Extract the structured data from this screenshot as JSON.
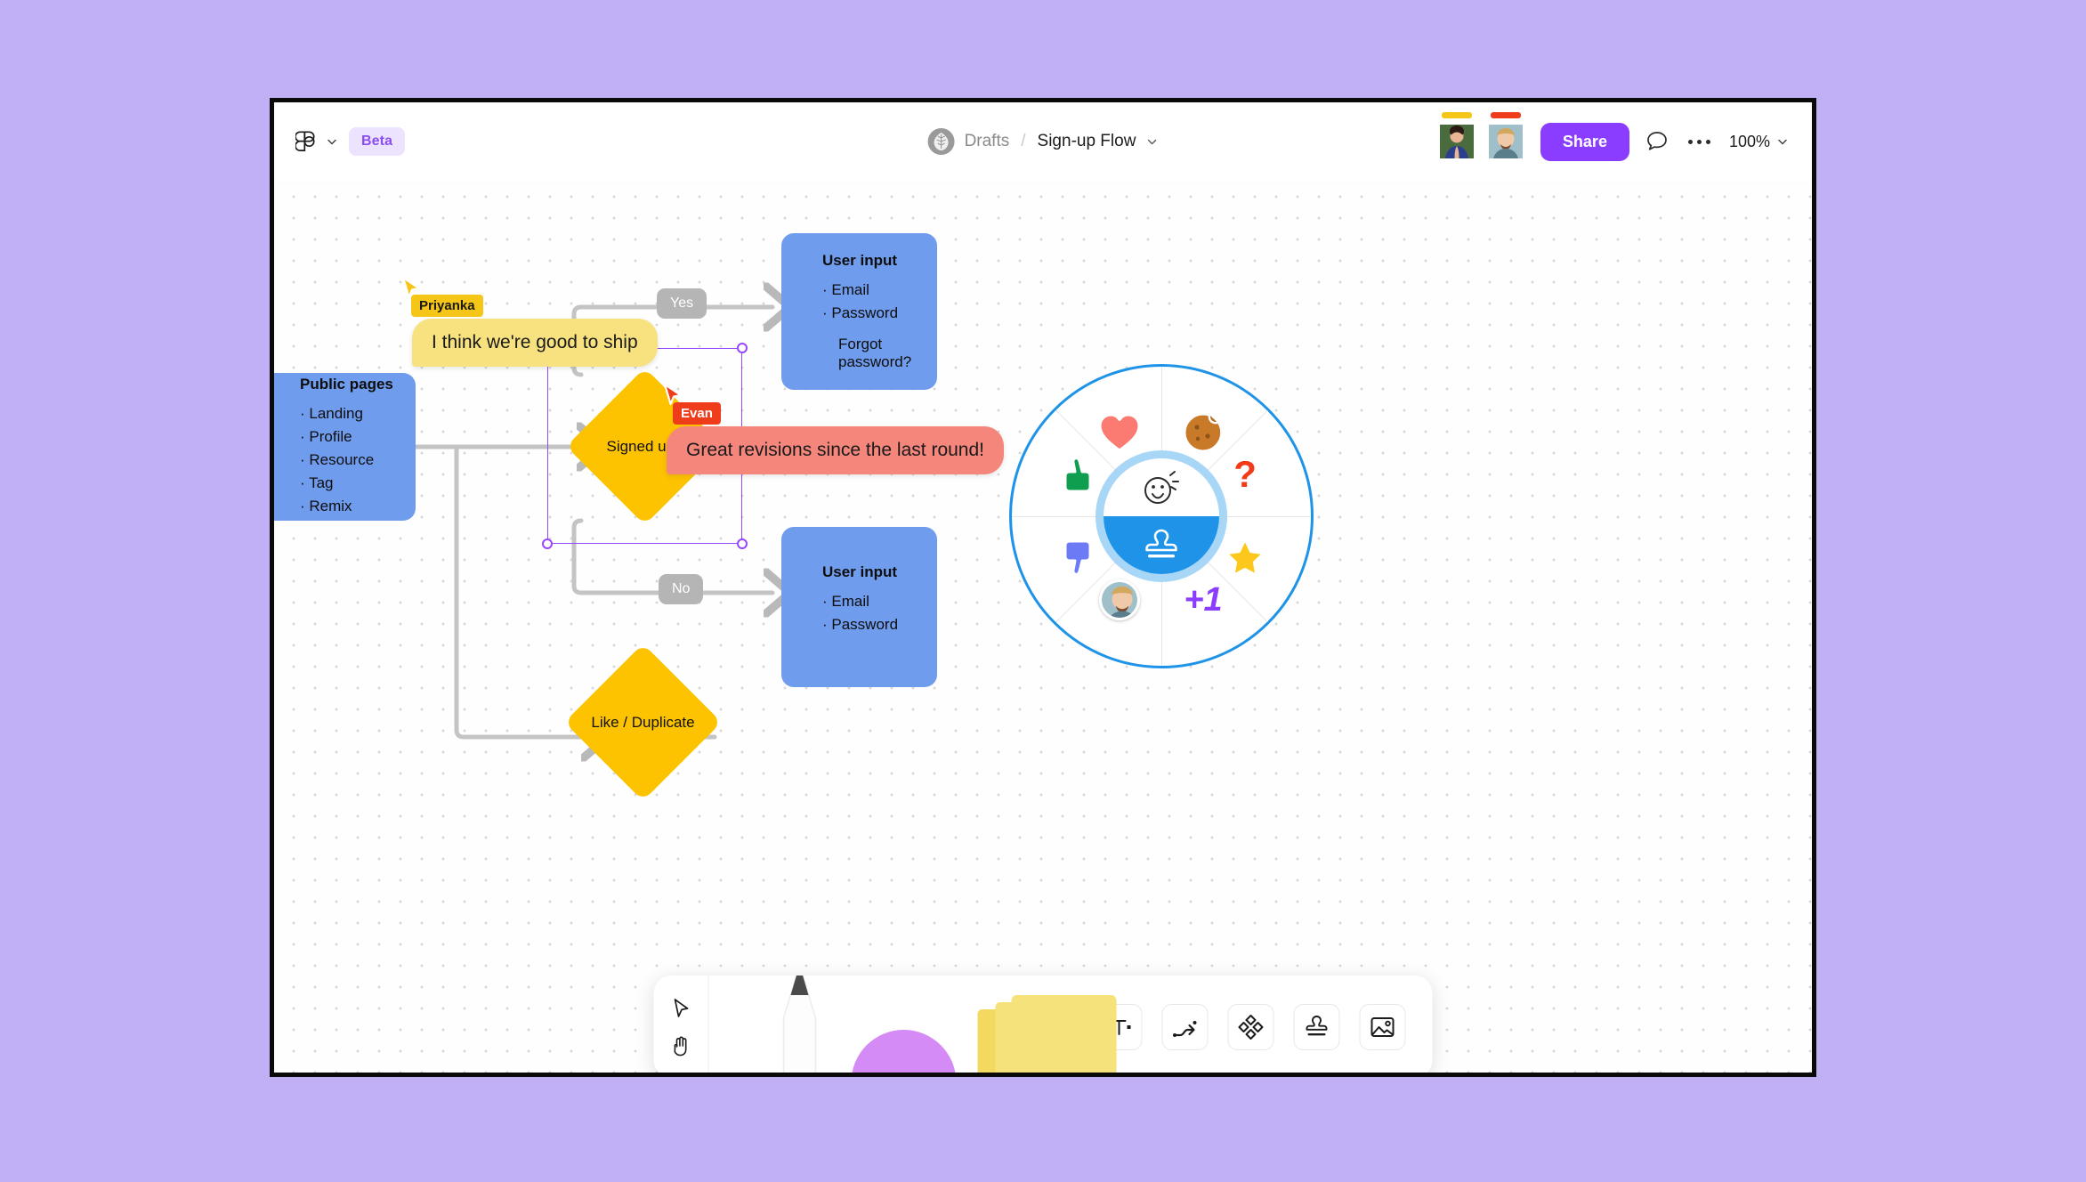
{
  "app": {
    "logo_icon": "figma-logo-icon",
    "logo_chevron_icon": "chevron-down-icon",
    "beta_badge": "Beta"
  },
  "breadcrumb": {
    "project": "Drafts",
    "separator": "/",
    "file_name": "Sign-up Flow",
    "chevron_icon": "chevron-down-icon",
    "avatar_icon": "leaf-avatar-icon"
  },
  "topbar_right": {
    "collaborators": [
      {
        "name": "Priyanka",
        "color": "#f5c518"
      },
      {
        "name": "Evan",
        "color": "#ef3d1b"
      }
    ],
    "share_label": "Share",
    "comment_icon": "comment-bubble-icon",
    "more_icon": "more-options-icon",
    "zoom_level": "100%",
    "zoom_chevron_icon": "chevron-down-icon"
  },
  "canvas": {
    "nodes": [
      {
        "id": "public-pages",
        "type": "rect",
        "title": "Public pages",
        "items": [
          "Landing",
          "Profile",
          "Resource",
          "Tag",
          "Remix"
        ],
        "color": "#6f9ced"
      },
      {
        "id": "user-input-top",
        "type": "rect",
        "title": "User input",
        "items": [
          "Email",
          "Password"
        ],
        "extra": "Forgot password?",
        "color": "#6f9ced"
      },
      {
        "id": "user-input-bottom",
        "type": "rect",
        "title": "User input",
        "items": [
          "Email",
          "Password"
        ],
        "color": "#6f9ced"
      },
      {
        "id": "signed-up",
        "type": "diamond",
        "label": "Signed up?",
        "color": "#fdc300",
        "selected": true
      },
      {
        "id": "like-duplicate",
        "type": "diamond",
        "label": "Like / Duplicate",
        "color": "#fdc300",
        "selected": false
      }
    ],
    "edge_labels": [
      {
        "id": "yes",
        "text": "Yes"
      },
      {
        "id": "no",
        "text": "No"
      }
    ],
    "cursors": [
      {
        "name": "Priyanka",
        "color": "#f5c518",
        "label_text_color": "#1a1a1a"
      },
      {
        "name": "Evan",
        "color": "#ef3d1b",
        "label_text_color": "#ffffff"
      }
    ],
    "comments": [
      {
        "author": "Priyanka",
        "text": "I think we're good to ship",
        "bubble_color": "#f7e27f"
      },
      {
        "author": "Evan",
        "text": "Great revisions since the last round!",
        "bubble_color": "#f5867c"
      }
    ],
    "reaction_wheel": {
      "ring_color": "#1e93e8",
      "items": [
        {
          "id": "heart",
          "icon": "heart-icon",
          "glyph": "❤",
          "color": "#fb7a72"
        },
        {
          "id": "cookie",
          "icon": "cookie-icon",
          "glyph": "🍪",
          "color": "#c97a28"
        },
        {
          "id": "question",
          "icon": "question-mark-icon",
          "glyph": "?",
          "color": "#f23a18"
        },
        {
          "id": "star",
          "icon": "star-icon",
          "glyph": "★",
          "color": "#fcc81e"
        },
        {
          "id": "plus-one",
          "icon": "plus-one-icon",
          "glyph": "+1",
          "color": "#8b3dff"
        },
        {
          "id": "avatar",
          "icon": "avatar-icon",
          "glyph": "",
          "color": "#cfd8dc"
        },
        {
          "id": "thumbs-down",
          "icon": "thumbs-down-icon",
          "glyph": "👎",
          "color": "#6c7af5"
        },
        {
          "id": "thumbs-up",
          "icon": "thumbs-up-icon",
          "glyph": "👍",
          "color": "#0f9d4f"
        }
      ],
      "center_top_icon": "smiley-face-icon",
      "center_bottom_icon": "stamp-icon"
    }
  },
  "toolbar": {
    "modes": [
      {
        "id": "select",
        "icon": "cursor-arrow-icon"
      },
      {
        "id": "hand",
        "icon": "hand-icon"
      }
    ],
    "creators": [
      {
        "id": "pen",
        "icon": "pen-tool-icon"
      },
      {
        "id": "shape",
        "icon": "circle-shape-icon",
        "color": "#d58bf5"
      },
      {
        "id": "sticky",
        "icon": "sticky-note-icon",
        "color": "#f6e27a"
      }
    ],
    "icons": [
      {
        "id": "text",
        "icon": "text-tool-icon"
      },
      {
        "id": "connector",
        "icon": "connector-arrow-icon"
      },
      {
        "id": "shapes",
        "icon": "shapes-diamond-icon"
      },
      {
        "id": "stamp",
        "icon": "stamp-tool-icon"
      },
      {
        "id": "image",
        "icon": "image-tool-icon"
      }
    ]
  }
}
